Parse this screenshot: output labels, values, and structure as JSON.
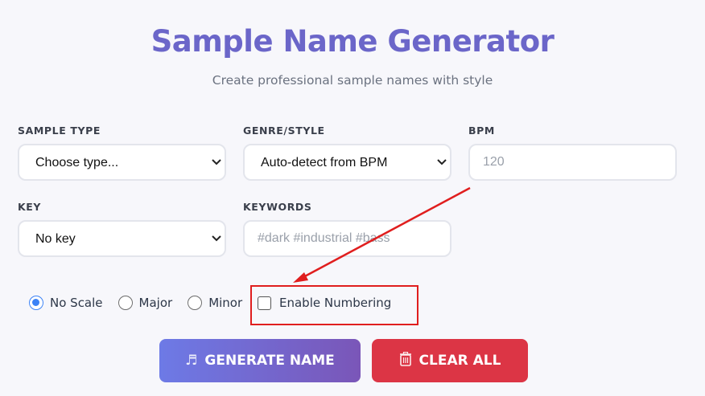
{
  "header": {
    "title": "Sample Name Generator",
    "subtitle": "Create professional sample names with style"
  },
  "fields": {
    "sample_type": {
      "label": "SAMPLE TYPE",
      "value": "Choose type..."
    },
    "genre": {
      "label": "GENRE/STYLE",
      "value": "Auto-detect from BPM"
    },
    "bpm": {
      "label": "BPM",
      "placeholder": "120"
    },
    "key": {
      "label": "KEY",
      "value": "No key"
    },
    "keywords": {
      "label": "KEYWORDS",
      "placeholder": "#dark #industrial #bass"
    }
  },
  "scale": {
    "options": [
      "No Scale",
      "Major",
      "Minor"
    ],
    "selected": "No Scale"
  },
  "numbering": {
    "label": "Enable Numbering",
    "checked": false
  },
  "buttons": {
    "generate": {
      "icon": "music-note-icon",
      "label": "GENERATE NAME"
    },
    "clear": {
      "icon": "trash-icon",
      "label": "CLEAR ALL"
    }
  },
  "annotation": {
    "color": "#e01e1e"
  },
  "colors": {
    "title": "#6b66c9",
    "accent_radio": "#3b82f6",
    "generate_gradient": [
      "#6d7ae6",
      "#7a56b8"
    ],
    "clear": "#dc3545"
  }
}
